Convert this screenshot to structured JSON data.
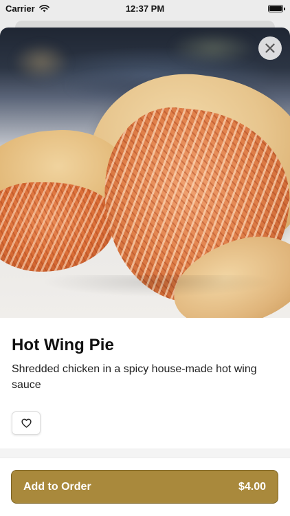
{
  "status_bar": {
    "carrier": "Carrier",
    "time": "12:37 PM"
  },
  "item": {
    "title": "Hot Wing Pie",
    "description": "Shredded chicken in a spicy house-made hot wing sauce"
  },
  "order_button": {
    "label": "Add to Order",
    "price": "$4.00"
  },
  "colors": {
    "accent": "#a9893c",
    "accent_border": "#7d6322"
  },
  "icons": {
    "wifi": "wifi-icon",
    "battery": "battery-icon",
    "close": "close-icon",
    "favorite": "heart-outline-icon"
  }
}
